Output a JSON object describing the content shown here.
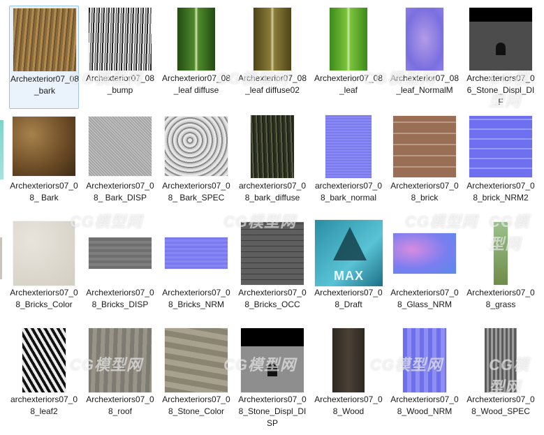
{
  "watermark": "CG模型网",
  "files": [
    {
      "name": "Archexterior07_08_bark",
      "kind": "bark",
      "selected": true
    },
    {
      "name": "Archexterior07_08_bump",
      "kind": "bump"
    },
    {
      "name": "Archexterior07_08_leaf diffuse",
      "kind": "leaf-green"
    },
    {
      "name": "Archexterior07_08_leaf diffuse02",
      "kind": "leaf-olive"
    },
    {
      "name": "Archexterior07_08_leaf",
      "kind": "leaf-bright"
    },
    {
      "name": "Archexterior07_08_leaf_NormalM",
      "kind": "leaf-normal"
    },
    {
      "name": "Archexteriors07_06_Stone_Displ_DIF",
      "kind": "stone-dark"
    },
    {
      "name": "Archexteriors07_08_ Bark",
      "kind": "dirt"
    },
    {
      "name": "Archexteriors07_08_ Bark_DISP",
      "kind": "noise"
    },
    {
      "name": "Archexteriors07_08_ Bark_SPEC",
      "kind": "noise-coarse"
    },
    {
      "name": "archexteriors07_08_bark_diffuse",
      "kind": "bark-dark"
    },
    {
      "name": "archexteriors07_08_bark_normal",
      "kind": "normal"
    },
    {
      "name": "Archexteriors07_08_brick",
      "kind": "brick"
    },
    {
      "name": "Archexteriors07_08_brick_NRM2",
      "kind": "brick-normal"
    },
    {
      "name": "Archexteriors07_08_Bricks_Color",
      "kind": "plaster"
    },
    {
      "name": "Archexteriors07_08_Bricks_DISP",
      "kind": "gray-band"
    },
    {
      "name": "Archexteriors07_08_Bricks_NRM",
      "kind": "normal-band"
    },
    {
      "name": "Archexteriors07_08_Bricks_OCC",
      "kind": "bricks-occ"
    },
    {
      "name": "Archexteriors07_08_Draft",
      "kind": "max-icon"
    },
    {
      "name": "Archexteriors07_08_Glass_NRM",
      "kind": "glass-normal"
    },
    {
      "name": "Archexteriors07_08_grass",
      "kind": "grass"
    },
    {
      "name": "archexteriors07_08_leaf2",
      "kind": "zebra"
    },
    {
      "name": "Archexteriors07_08_roof",
      "kind": "roof"
    },
    {
      "name": "Archexteriors07_08_Stone_Color",
      "kind": "stone-color"
    },
    {
      "name": "Archexteriors07_08_Stone_Displ_DISP",
      "kind": "stone-disp"
    },
    {
      "name": "Archexteriors07_08_Wood",
      "kind": "wood-dark"
    },
    {
      "name": "Archexteriors07_08_Wood_NRM",
      "kind": "wood-normal"
    },
    {
      "name": "Archexteriors07_08_Wood_SPEC",
      "kind": "wood-spec"
    }
  ],
  "max_badge": "MAX"
}
